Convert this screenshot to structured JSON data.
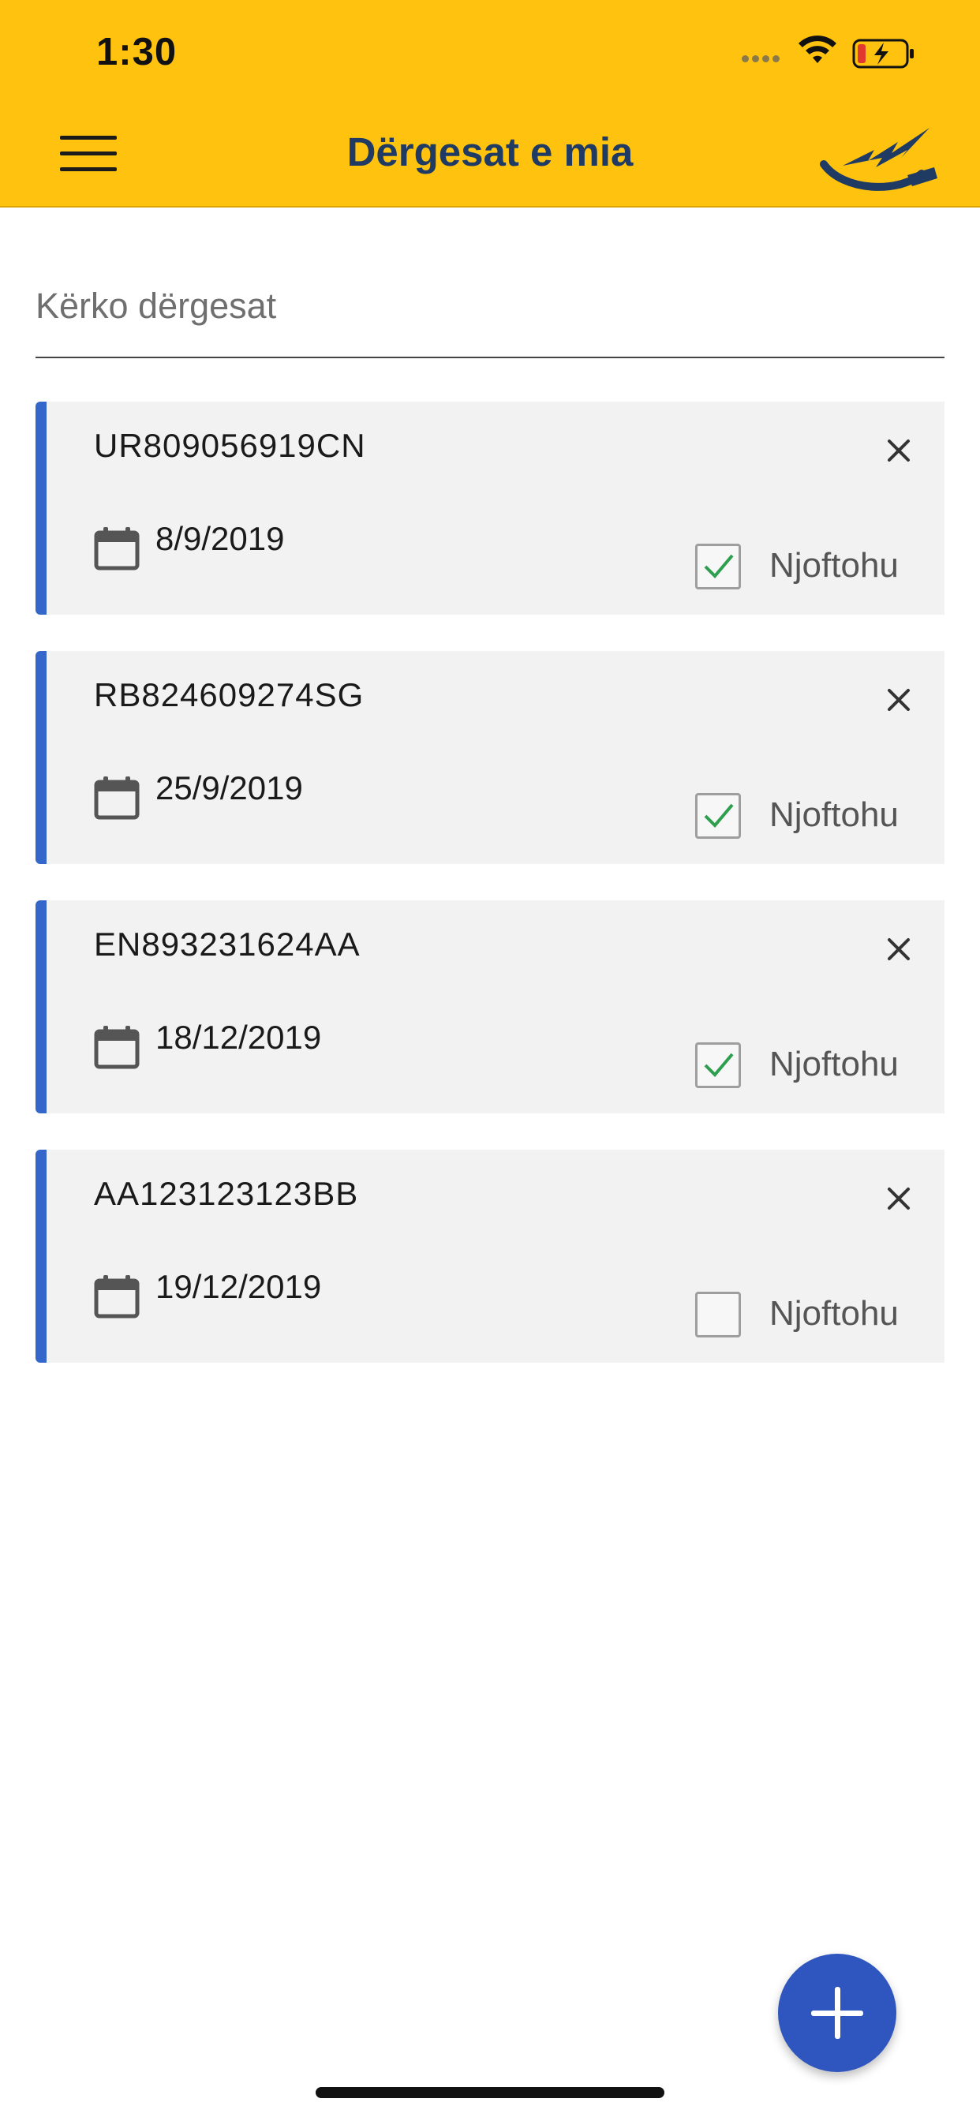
{
  "status_bar": {
    "time": "1:30"
  },
  "header": {
    "title": "Dërgesat e mia"
  },
  "search": {
    "placeholder": "Kërko dërgesat"
  },
  "notify_label": "Njoftohu",
  "shipments": [
    {
      "code": "UR809056919CN",
      "date": "8/9/2019",
      "notify": true
    },
    {
      "code": "RB824609274SG",
      "date": "25/9/2019",
      "notify": true
    },
    {
      "code": "EN893231624AA",
      "date": "18/12/2019",
      "notify": true
    },
    {
      "code": "AA123123123BB",
      "date": "19/12/2019",
      "notify": false
    }
  ],
  "colors": {
    "header_bg": "#FFC20E",
    "title": "#1F3B64",
    "card_accent": "#3467C9",
    "check": "#2E9E4F",
    "fab": "#2F56BE"
  },
  "icons": [
    "menu-icon",
    "logo-icon",
    "close-icon",
    "calendar-icon",
    "check-icon",
    "plus-icon",
    "wifi-icon",
    "battery-icon"
  ]
}
